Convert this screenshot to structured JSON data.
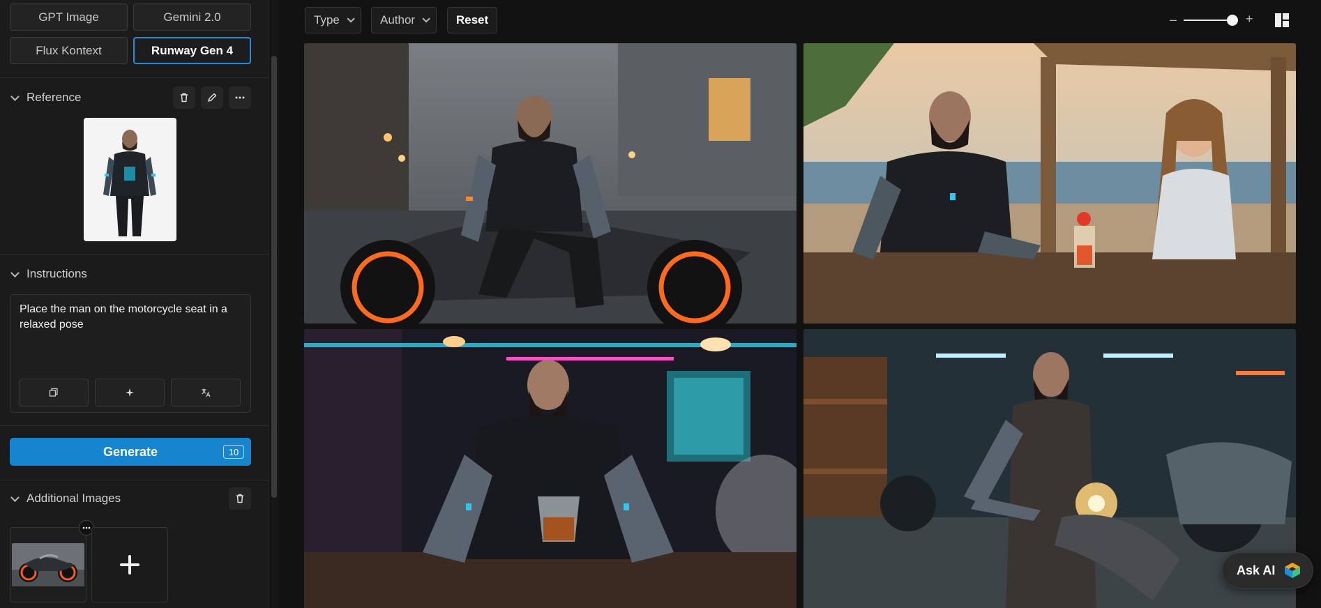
{
  "models": [
    {
      "label": "GPT Image",
      "active": false
    },
    {
      "label": "Gemini 2.0",
      "active": false
    },
    {
      "label": "Flux Kontext",
      "active": false
    },
    {
      "label": "Runway Gen 4",
      "active": true
    }
  ],
  "reference": {
    "title": "Reference"
  },
  "instructions": {
    "title": "Instructions",
    "text": "Place the man on the motorcycle seat in a relaxed pose"
  },
  "generate": {
    "label": "Generate",
    "credits": "10"
  },
  "additional_images": {
    "title": "Additional Images"
  },
  "filters": {
    "type_label": "Type",
    "author_label": "Author",
    "reset_label": "Reset"
  },
  "zoom": {
    "minus": "–",
    "plus": "+",
    "level": 0.85
  },
  "ask_ai": {
    "label": "Ask AI"
  },
  "colors": {
    "accent": "#1784cf",
    "active_border": "#1d8fd8"
  }
}
